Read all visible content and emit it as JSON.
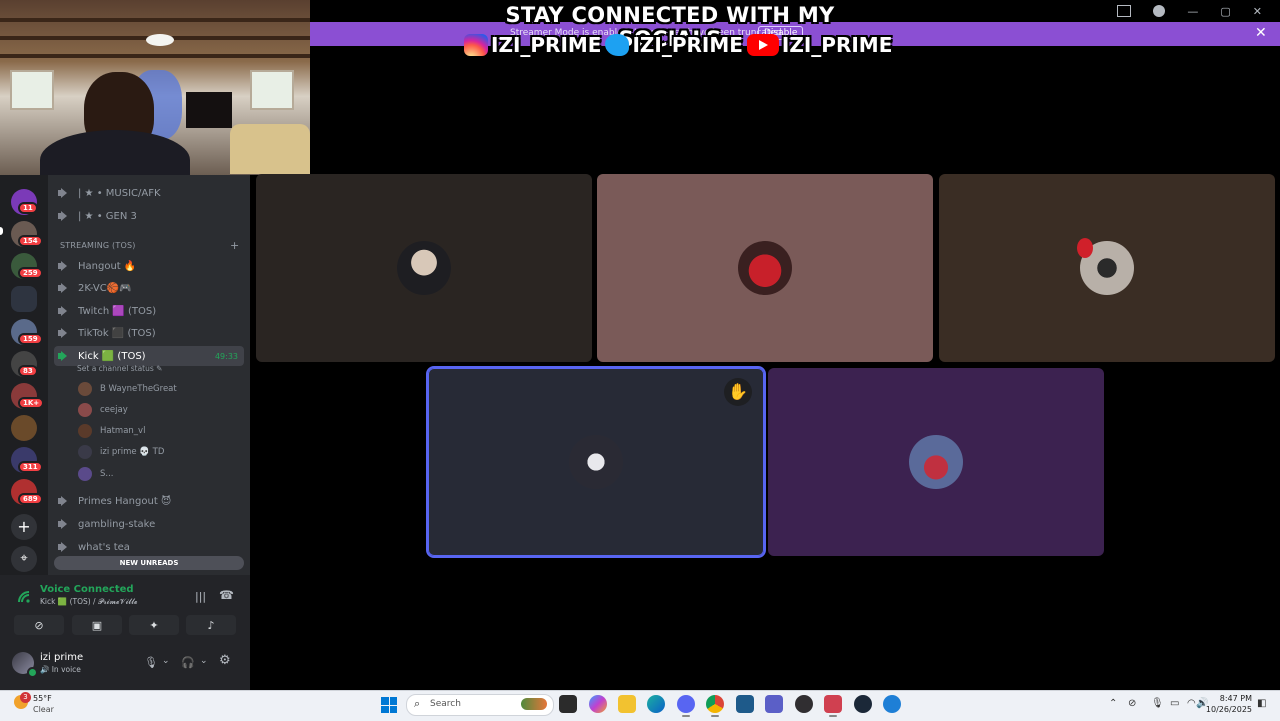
{
  "overlay": {
    "title": "STAY CONNECTED WITH MY SOCIALS",
    "socials": [
      {
        "icon": "instagram-icon",
        "handle": "IZI_PRIME"
      },
      {
        "icon": "twitter-icon",
        "handle": "IZI_PRIME"
      },
      {
        "icon": "youtube-icon",
        "handle": "IZI_PRIME"
      }
    ]
  },
  "notice_bar": {
    "text": "Streamer Mode is enabled. Usernames have been truncated.",
    "disable_label": "Disable",
    "close_glyph": "✕",
    "color": "#8b4fd3"
  },
  "window_controls": {
    "minimize": "—",
    "maximize": "▢",
    "close": "✕"
  },
  "server_rail": {
    "badges": [
      "11",
      "154",
      "259",
      "159",
      "83",
      "1K+",
      "311",
      "689"
    ],
    "add_glyph": "+",
    "discover_glyph": "⌖"
  },
  "channels": {
    "top": [
      {
        "name": "| ★ • MUSIC/AFK"
      },
      {
        "name": "| ★ • GEN 3"
      }
    ],
    "category": "STREAMING (TOS)",
    "category_plus": "+",
    "list": [
      {
        "name": "Hangout 🔥"
      },
      {
        "name": "2K-VC🏀🎮"
      },
      {
        "name": "Twitch 🟪 (TOS)"
      },
      {
        "name": "TikTok ⬛ (TOS)"
      },
      {
        "name": "Kick 🟩 (TOS)",
        "active": true,
        "timer": "49:33",
        "status": "Set a channel status ✎"
      }
    ],
    "members": [
      {
        "name": "B WayneTheGreat"
      },
      {
        "name": "ceejay"
      },
      {
        "name": "Hatman_vl"
      },
      {
        "name": "izi prime 💀 TD"
      },
      {
        "name": "S..."
      }
    ],
    "after": [
      {
        "name": "Primes Hangout 😈"
      },
      {
        "name": "gambling-stake"
      },
      {
        "name": "what's tea"
      }
    ],
    "new_unreads": "NEW UNREADS"
  },
  "voice_panel": {
    "title": "Voice Connected",
    "subtitle": "Kick 🟩 (TOS) / 𝓟𝓻𝓲𝓶𝓮𝓥𝓲𝓵𝓵𝓮",
    "buttons": [
      "camera-off",
      "screen-share",
      "activities",
      "soundboard"
    ],
    "glyphs": {
      "camera-off": "⊘",
      "screen-share": "▣",
      "activities": "✦",
      "soundboard": "♪"
    },
    "noise_glyph": "|||",
    "disconnect_glyph": "☎"
  },
  "user": {
    "name": "izi prime",
    "status": "🔊 In voice",
    "mic_glyph": "🎙",
    "headset_glyph": "🎧",
    "settings_glyph": "⚙",
    "chevron": "⌄"
  },
  "tiles": [
    {
      "color": "#2a2522"
    },
    {
      "color": "#7a5a58"
    },
    {
      "color": "#3a2d24"
    },
    {
      "color": "#272a36",
      "speaking": true,
      "raised_hand": "✋"
    },
    {
      "color": "#3c2250"
    }
  ],
  "taskbar": {
    "weather_temp": "55°F",
    "weather_desc": "Clear",
    "weather_badge": "3",
    "search_label": "Search",
    "time": "8:47 PM",
    "date": "10/26/2025"
  }
}
